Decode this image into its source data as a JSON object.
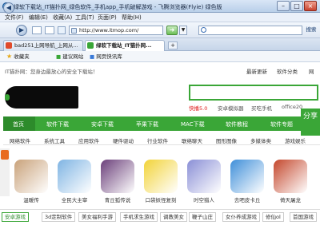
{
  "window": {
    "title": "绿软下载站_IT猫扑网_绿色软件_手机app_手机破解游戏 - 飞腾浏览器(Flyie) 绿色版",
    "controls": {
      "minimize": "–",
      "maximize": "□",
      "close": "×"
    }
  },
  "menu": [
    "文件(F)",
    "编辑(E)",
    "收藏(A)",
    "工具(T)",
    "页面(P)",
    "帮助(H)"
  ],
  "nav": {
    "back": "◀",
    "forward": "▶",
    "address": "http://www.itmop.com/",
    "go": "➜",
    "search_placeholder": "",
    "search_button": "搜索"
  },
  "tabs": [
    {
      "label": "bad251上网导航_上网从..."
    },
    {
      "label": "绿软下载站_IT猫扑网..."
    }
  ],
  "favorites": [
    {
      "label": "收藏夹"
    },
    {
      "label": "建议网站"
    },
    {
      "label": "网页快讯库"
    }
  ],
  "site": {
    "welcome": "IT猫扑网：您身边最放心的安全下载站！",
    "top_links": [
      "最新更新",
      "软件分类",
      "网"
    ],
    "hot_words": [
      {
        "text": "快播5.0",
        "hot": true
      },
      {
        "text": "安卓模拟器",
        "hot": false
      },
      {
        "text": "买吃手机",
        "hot": false
      },
      {
        "text": "office20",
        "hot": false
      }
    ],
    "main_nav": [
      "首页",
      "软件下载",
      "安卓下载",
      "苹果下载",
      "MAC下载",
      "软件教程",
      "软件专题"
    ],
    "share": "分享",
    "sub_nav": [
      "网络软件",
      "系统工具",
      "应用软件",
      "硬件驱动",
      "行业软件",
      "联络聊天",
      "图形图像",
      "多媒体类",
      "游戏娱乐"
    ],
    "apps": [
      {
        "name": "温暖传",
        "color": "#c9a27a"
      },
      {
        "name": "全民大主宰",
        "color": "#7fb4e3"
      },
      {
        "name": "青丘狐传说",
        "color": "#6b3f7a"
      },
      {
        "name": "口袋妖怪复刻",
        "color": "#f2d338"
      },
      {
        "name": "时空猎人",
        "color": "#8a8fd6"
      },
      {
        "name": "去吧皮卡丘",
        "color": "#3f8fd9"
      },
      {
        "name": "倚天屠龙",
        "color": "#c4472c"
      }
    ],
    "bottom_tags": [
      "安卓游戏",
      "3d定制软件",
      "美女福利手游",
      "手机求生游戏",
      "调教美女",
      "鞭子山庄",
      "女仆养成游戏",
      "修仙ol",
      "首国游戏"
    ]
  }
}
